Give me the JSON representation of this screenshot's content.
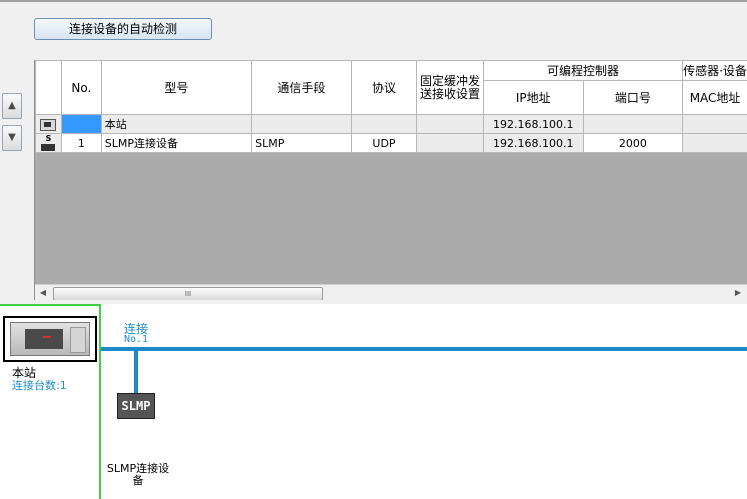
{
  "toolbar": {
    "detect_label": "连接设备的自动检测"
  },
  "side": {
    "up_icon": "▲",
    "down_icon": "▼"
  },
  "table": {
    "headers": {
      "no": "No.",
      "model": "型号",
      "comm_means": "通信手段",
      "protocol": "协议",
      "fixed_buffer": "固定缓冲发送接收设置",
      "plc_group": "可编程控制器",
      "ip": "IP地址",
      "port": "端口号",
      "sensor_group": "传感器·设备",
      "mac": "MAC地址"
    },
    "rows": [
      {
        "no": "",
        "model": "本站",
        "comm_means": "",
        "protocol": "",
        "fixed_buffer": "",
        "ip": "192.168.100.1",
        "port": "",
        "mac": ""
      },
      {
        "no": "1",
        "model": "SLMP连接设备",
        "comm_means": "SLMP",
        "protocol": "UDP",
        "fixed_buffer": "",
        "ip": "192.168.100.1",
        "port": "2000",
        "mac": ""
      }
    ],
    "scrollbar_grip": "III",
    "slmp_icon_letter": "S"
  },
  "diagram": {
    "own_station_label": "本站",
    "connection_count": "连接台数:1",
    "connection_title": "连接",
    "connection_no": "No.1",
    "device_box_label": "SLMP",
    "device_name": "SLMP连接设备"
  },
  "colors": {
    "bus": "#1b8ac6",
    "selection": "#3399ff",
    "frame_green": "#3fd13f"
  }
}
